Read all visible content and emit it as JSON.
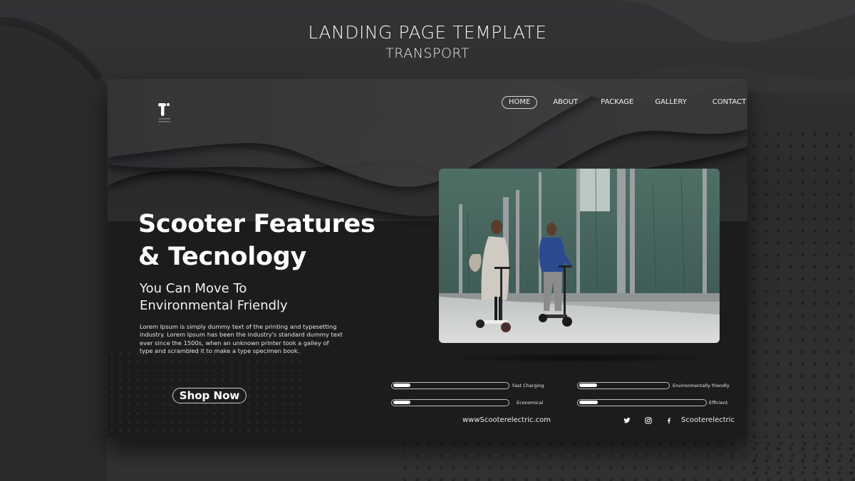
{
  "heading": {
    "title": "LANDING PAGE TEMPLATE",
    "subtitle": "TRANSPORT"
  },
  "logo": {
    "icon": "t-letter-logo",
    "tagline": "SCOOTER ELECTRIC"
  },
  "nav": {
    "items": [
      {
        "label": "HOME",
        "active": true
      },
      {
        "label": "ABOUT",
        "active": false
      },
      {
        "label": "PACKAGE",
        "active": false
      },
      {
        "label": "GALLERY",
        "active": false
      },
      {
        "label": "CONTACT",
        "active": false
      }
    ]
  },
  "hero": {
    "title_line1": "Scooter Features",
    "title_line2": "& Tecnology",
    "subtitle_line1": "You Can Move To",
    "subtitle_line2": "Environmental Friendly",
    "body": "Lorem Ipsum is simply dummy text of the printing and typesetting industry. Lorem Ipsum has been the industry's standard dummy text ever since the 1500s, when an unknown printer took a galley of type and scrambled it to make a type specimen book.",
    "cta_label": "Shop Now",
    "image_alt": "Two people riding electric scooters past a glass building"
  },
  "features": [
    {
      "label": "Fast Charging",
      "progress": 0.15
    },
    {
      "label": "Economical",
      "progress": 0.15
    },
    {
      "label": "Environmentally friendly",
      "progress": 0.2
    },
    {
      "label": "Efficient",
      "progress": 0.15
    }
  ],
  "footer": {
    "website": "wwwScooterelectric.com",
    "social_icons": [
      "twitter-icon",
      "instagram-icon",
      "facebook-icon"
    ],
    "handle": "Scooterelectric"
  },
  "colors": {
    "background": "#2f2f31",
    "card": "#1c1c1d",
    "text": "#ffffff",
    "accent_bar": "#ffffff"
  }
}
